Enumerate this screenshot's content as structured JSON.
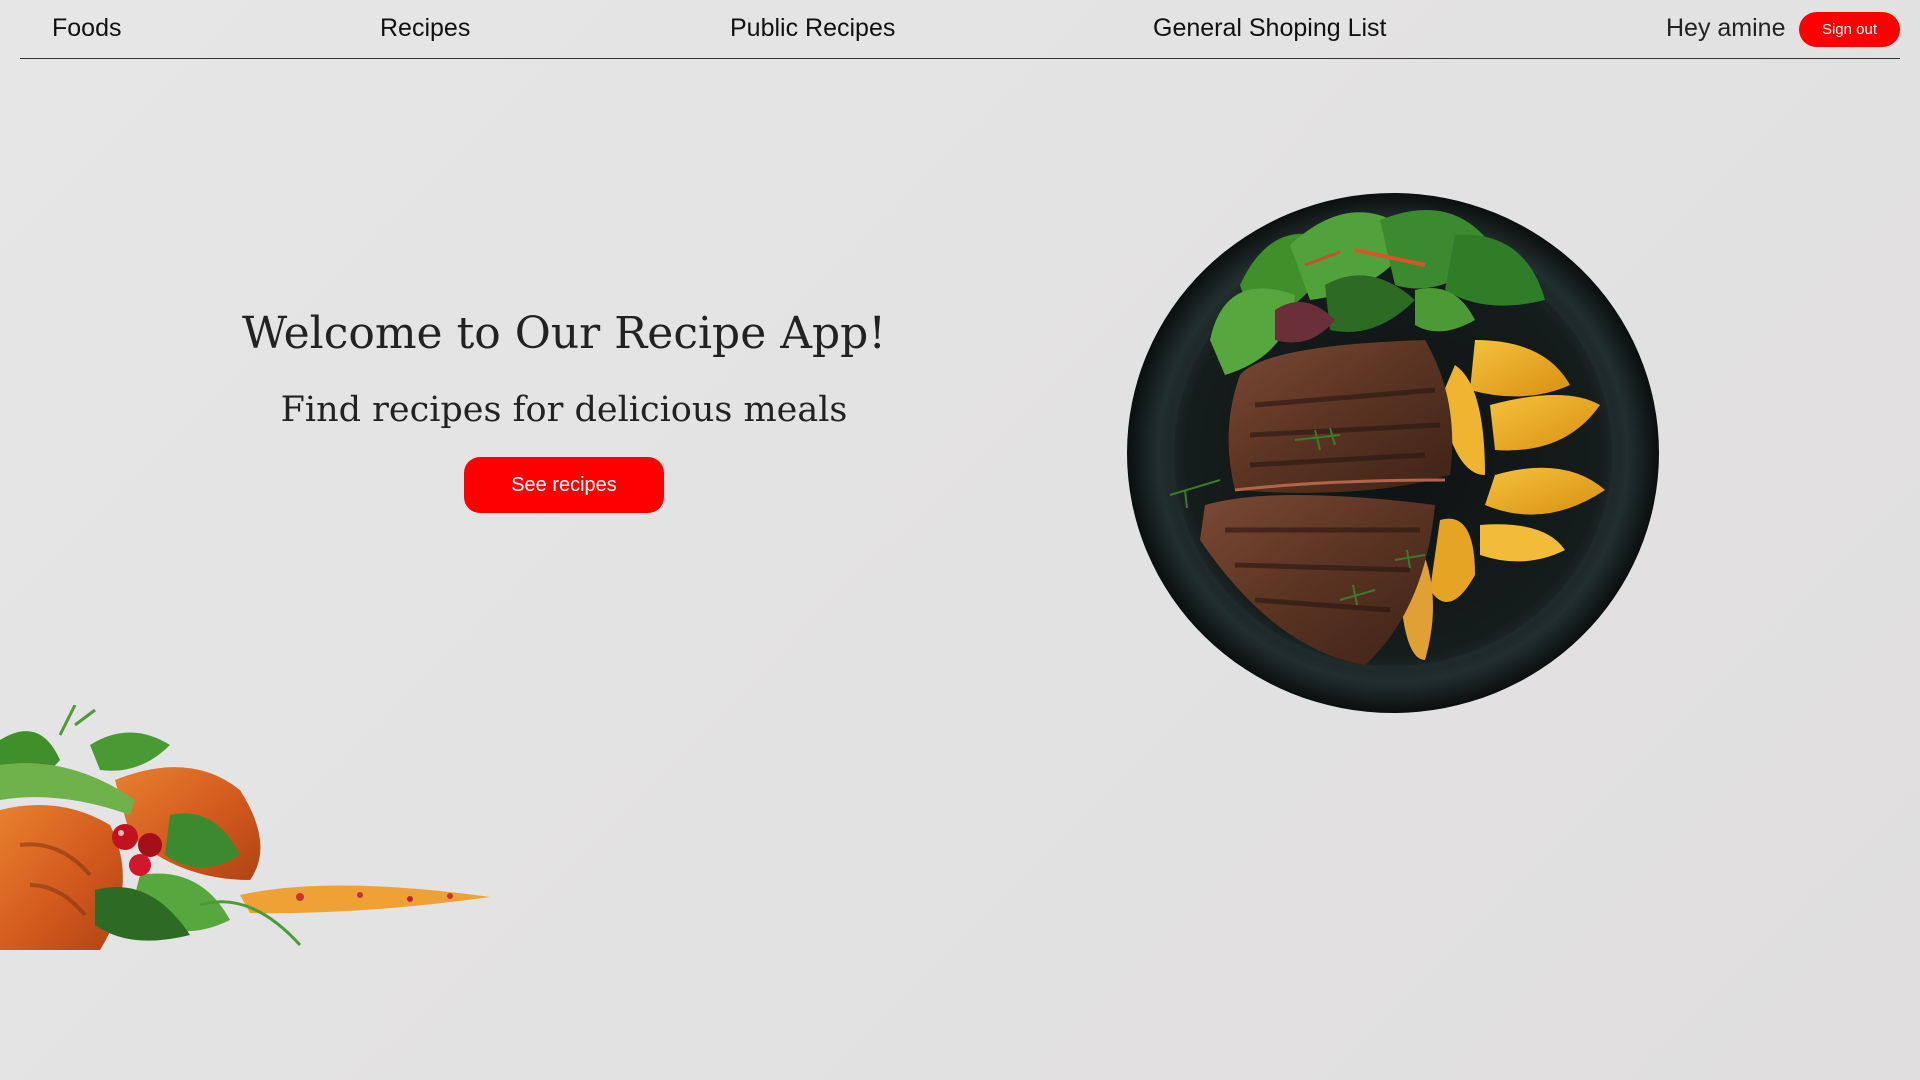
{
  "nav": {
    "links": [
      "Foods",
      "Recipes",
      "Public Recipes",
      "General Shoping List"
    ],
    "greeting": "Hey amine",
    "sign_out_label": "Sign out"
  },
  "hero": {
    "title": "Welcome to Our Recipe App!",
    "subtitle": "Find recipes for delicious meals",
    "cta_label": "See recipes"
  },
  "colors": {
    "accent": "#ff0000",
    "text": "#222222",
    "background": "#e4e3e3"
  },
  "images": {
    "plate": "steak-and-potato-plate",
    "salmon": "grilled-salmon-with-salad"
  }
}
